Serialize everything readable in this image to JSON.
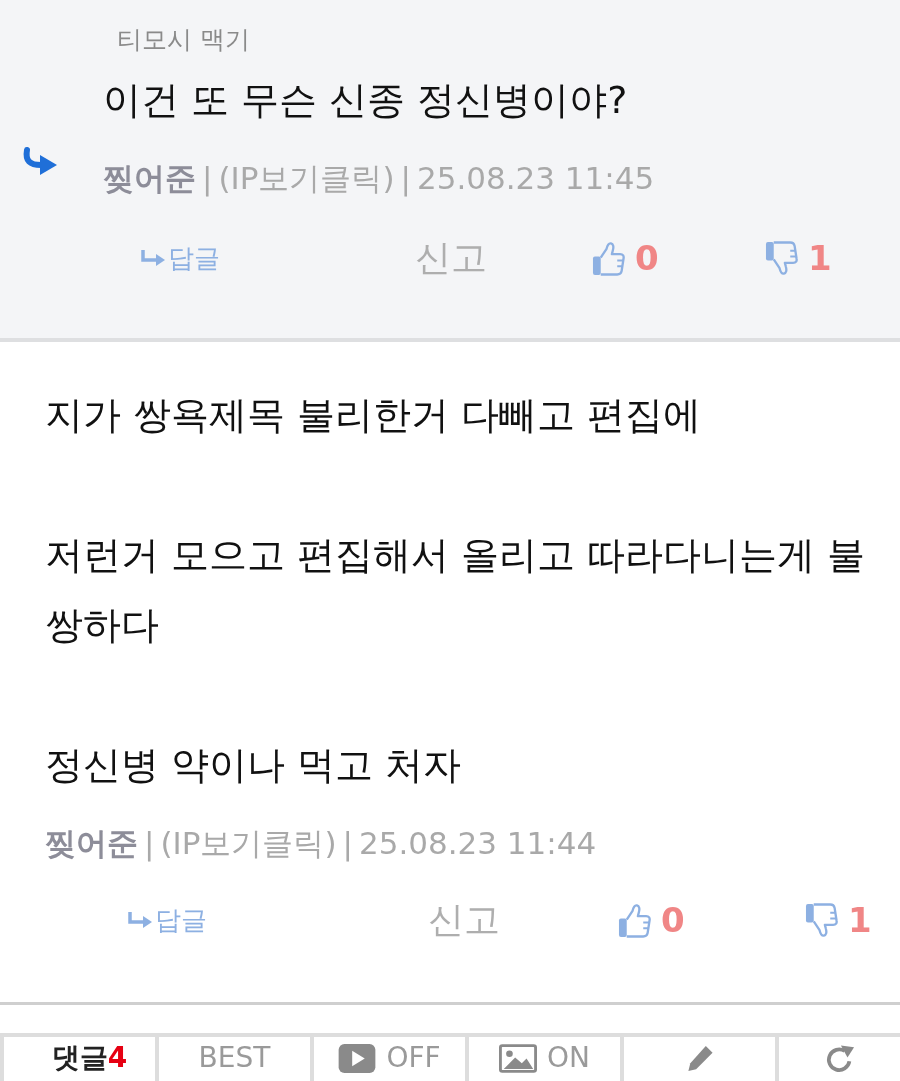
{
  "reply": {
    "reply_to": "티모시 맥기",
    "text": "이건 또 무슨 신종 정신병이야?",
    "meta": [
      {
        "kind": "author",
        "text": "찢어준"
      },
      {
        "kind": "separator",
        "text": "|"
      },
      {
        "kind": "ip_link",
        "text": "(IP보기클릭)"
      },
      {
        "kind": "separator",
        "text": "|"
      },
      {
        "kind": "timestamp",
        "text": "25.08.23 11:45"
      }
    ],
    "actions": {
      "reply": "답글",
      "report": "신고",
      "likes": "0",
      "dislikes": "1"
    }
  },
  "comment": {
    "paragraphs": [
      "지가 쌍욕제목 불리한거 다빼고 편집에",
      "저런거 모으고 편집해서 올리고 따라다니는게 불쌍하다",
      "정신병 약이나 먹고 처자"
    ],
    "meta": [
      {
        "kind": "author",
        "text": "찢어준"
      },
      {
        "kind": "separator",
        "text": "|"
      },
      {
        "kind": "ip_link",
        "text": "(IP보기클릭)"
      },
      {
        "kind": "separator",
        "text": "|"
      },
      {
        "kind": "timestamp",
        "text": "25.08.23 11:44"
      }
    ],
    "actions": {
      "reply": "답글",
      "report": "신고",
      "likes": "0",
      "dislikes": "1"
    }
  },
  "toolbar": [
    {
      "kind": "comments",
      "label": "댓글",
      "count": "4"
    },
    {
      "kind": "best",
      "label": "BEST"
    },
    {
      "kind": "video",
      "label": "OFF"
    },
    {
      "kind": "image",
      "label": "ON"
    },
    {
      "kind": "write"
    },
    {
      "kind": "refresh"
    }
  ]
}
